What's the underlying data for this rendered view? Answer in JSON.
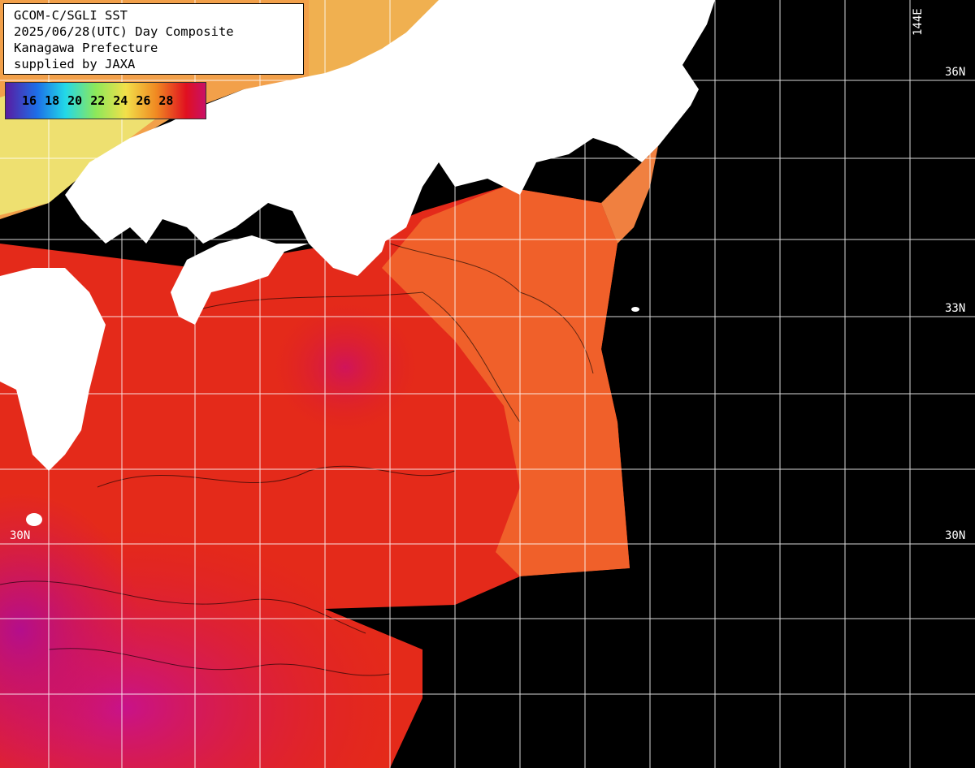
{
  "title": {
    "line1": "GCOM-C/SGLI SST",
    "line2": "2025/06/28(UTC) Day Composite",
    "line3": "Kanagawa Prefecture",
    "line4": "supplied by JAXA"
  },
  "legend": {
    "labels": [
      "16",
      "18",
      "20",
      "22",
      "24",
      "26",
      "28"
    ],
    "colors": [
      "#5a1aa0",
      "#1d6fe8",
      "#22d8e8",
      "#8ce85a",
      "#f2e04a",
      "#f08a22",
      "#e01020"
    ]
  },
  "latitude_labels": {
    "lat36_right": "36N",
    "lat33_right": "33N",
    "lat30_left": "30N",
    "lat30_right": "30N"
  },
  "longitude_labels": {
    "lon144": "144E"
  },
  "colors": {
    "land": "#ffffff",
    "no_data": "#000000",
    "grid": "#ffffff",
    "sst_warm": "#e02020",
    "sst_hot": "#c01060",
    "sst_mid": "#f07030",
    "sst_cool": "#f2e060"
  }
}
